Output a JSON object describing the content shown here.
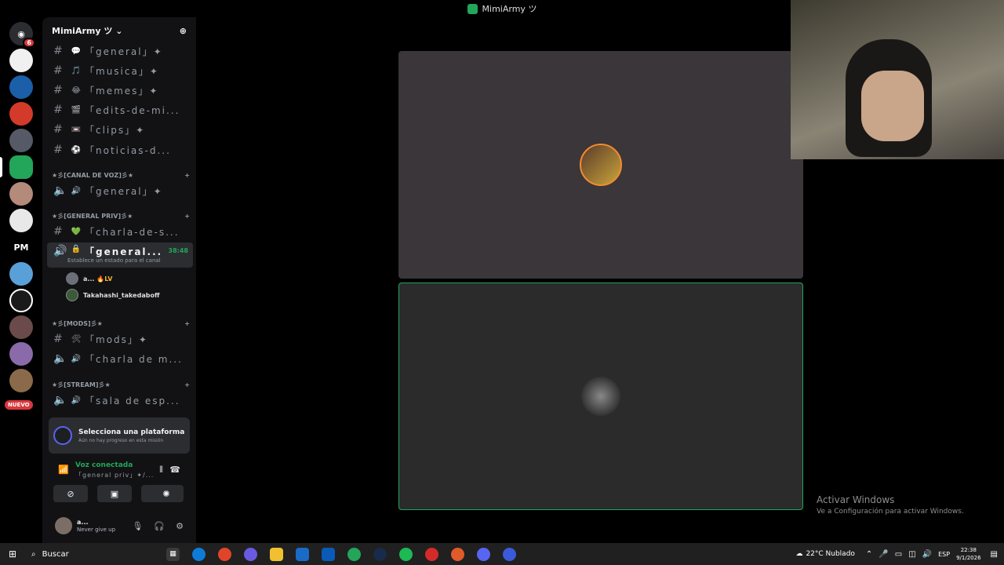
{
  "window": {
    "title": "MimiArmy ツ"
  },
  "rail": {
    "home_badge": "6",
    "pm_label": "PM",
    "nuevo_label": "NUEVO"
  },
  "server": {
    "name": "MimiArmy ツ"
  },
  "channels": [
    {
      "emoji": "💬",
      "name": "「general」✦"
    },
    {
      "emoji": "🎵",
      "name": "「musica」✦"
    },
    {
      "emoji": "😂",
      "name": "「memes」✦"
    },
    {
      "emoji": "🎬",
      "name": "「edits-de-mi..."
    },
    {
      "emoji": "📼",
      "name": "「clips」✦"
    },
    {
      "emoji": "⚽",
      "name": "「noticias-d..."
    }
  ],
  "categories": {
    "voz": "★彡[CANAL DE VOZ]彡★",
    "priv": "★彡[GENERAL PRIV]彡★",
    "mods": "★彡[MODS]彡★",
    "stream": "★彡[STREAM]彡★"
  },
  "voz_channels": [
    {
      "emoji": "🔊",
      "name": "「general」✦"
    }
  ],
  "priv_channels": [
    {
      "emoji": "💚",
      "name": "「charla-de-s..."
    }
  ],
  "active_voice": {
    "name": "「general...",
    "time": "38:48",
    "status": "Establece un estado para el canal",
    "users": [
      {
        "name": "a...",
        "tag": "🔥LV"
      },
      {
        "name": "Takahashi_takedaboff"
      }
    ]
  },
  "mods_channels": [
    {
      "emoji": "🛠",
      "name": "「mods」✦"
    },
    {
      "emoji": "🔊",
      "name": "「charla de m..."
    }
  ],
  "stream_channels": [
    {
      "emoji": "🔊",
      "name": "「sala de esp..."
    }
  ],
  "quest": {
    "title": "Selecciona una plataforma",
    "subtitle": "Aún no hay progreso en esta misión"
  },
  "voice_panel": {
    "title": "Voz conectada",
    "channel": "「general priv」✦/..."
  },
  "user_panel": {
    "name": "a...",
    "status": "Never give up"
  },
  "watermark": {
    "line1": "Activar Windows",
    "line2": "Ve a Configuración para activar Windows."
  },
  "taskbar": {
    "search": "Buscar",
    "weather": "22°C Nublado",
    "lang": "ESP",
    "time": "22:38",
    "date": "9/1/2026"
  }
}
